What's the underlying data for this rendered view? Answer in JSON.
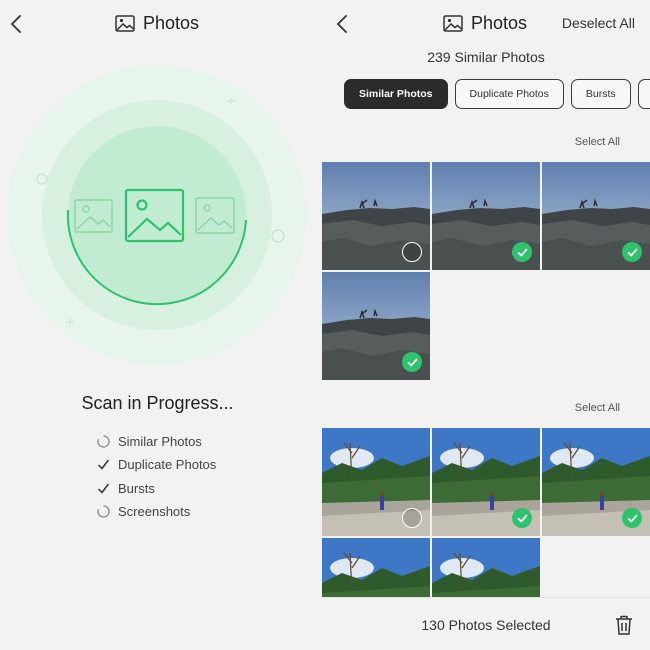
{
  "left": {
    "title": "Photos",
    "back_icon": "chevron-left-icon",
    "title_icon": "photo-icon",
    "progress_title": "Scan in Progress...",
    "scan_items": [
      {
        "label": "Similar Photos",
        "status": "loading"
      },
      {
        "label": "Duplicate Photos",
        "status": "done"
      },
      {
        "label": "Bursts",
        "status": "done"
      },
      {
        "label": "Screenshots",
        "status": "loading"
      }
    ],
    "accent_color": "#2cc36b"
  },
  "right": {
    "title": "Photos",
    "deselect_label": "Deselect All",
    "similar_count": "239 Similar Photos",
    "filters": [
      {
        "label": "Similar Photos",
        "active": true
      },
      {
        "label": "Duplicate Photos",
        "active": false
      },
      {
        "label": "Bursts",
        "active": false
      }
    ],
    "select_all_label": "Select All",
    "groups": [
      {
        "scene": "rock",
        "tiles": [
          {
            "selected": false
          },
          {
            "selected": true
          },
          {
            "selected": true
          },
          {
            "selected": true
          }
        ]
      },
      {
        "scene": "river",
        "tiles": [
          {
            "selected": false
          },
          {
            "selected": true
          },
          {
            "selected": true
          },
          {
            "selected": null
          },
          {
            "selected": null
          }
        ]
      }
    ],
    "selected_count": "130 Photos Selected",
    "trash_icon": "trash-icon"
  }
}
